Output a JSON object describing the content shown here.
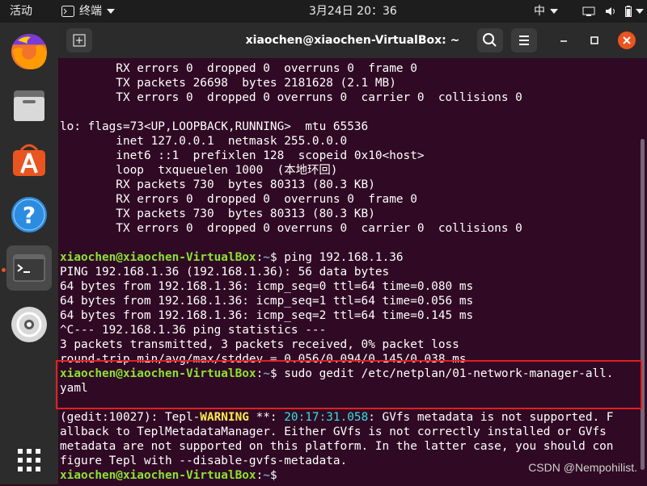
{
  "topbar": {
    "activities": "活动",
    "app_menu": "终端",
    "clock": "3月24日  20：36",
    "input_method": "中"
  },
  "window": {
    "title": "xiaochen@xiaochen-VirtualBox: ~"
  },
  "dock": {
    "items": [
      "firefox-icon",
      "files-icon",
      "software-icon",
      "help-icon",
      "terminal-icon",
      "dvd-icon"
    ],
    "apps_grid": "show-applications-icon"
  },
  "terminal": {
    "lines": [
      "        RX errors 0  dropped 0  overruns 0  frame 0",
      "        TX packets 26698  bytes 2181628 (2.1 MB)",
      "        TX errors 0  dropped 0 overruns 0  carrier 0  collisions 0",
      "",
      "lo: flags=73<UP,LOOPBACK,RUNNING>  mtu 65536",
      "        inet 127.0.0.1  netmask 255.0.0.0",
      "        inet6 ::1  prefixlen 128  scopeid 0x10<host>",
      "        loop  txqueuelen 1000  (本地环回)",
      "        RX packets 730  bytes 80313 (80.3 KB)",
      "        RX errors 0  dropped 0  overruns 0  frame 0",
      "        TX packets 730  bytes 80313 (80.3 KB)",
      "        TX errors 0  dropped 0 overruns 0  carrier 0  collisions 0",
      ""
    ],
    "prompt_user": "xiaochen@xiaochen-VirtualBox",
    "prompt_sep": ":",
    "prompt_path": "~",
    "prompt_sym": "$",
    "cmd1": " ping 192.168.1.36",
    "ping_output": [
      "PING 192.168.1.36 (192.168.1.36): 56 data bytes",
      "64 bytes from 192.168.1.36: icmp_seq=0 ttl=64 time=0.080 ms",
      "64 bytes from 192.168.1.36: icmp_seq=1 ttl=64 time=0.056 ms",
      "64 bytes from 192.168.1.36: icmp_seq=2 ttl=64 time=0.145 ms",
      "^C--- 192.168.1.36 ping statistics ---",
      "3 packets transmitted, 3 packets received, 0% packet loss",
      "round-trip min/avg/max/stddev = 0.056/0.094/0.145/0.038 ms"
    ],
    "cmd2_part1": " sudo gedit /etc/netplan/01-network-manager-all.",
    "cmd2_part2": "yaml",
    "gedit_prefix": "(gedit:10027): Tepl-",
    "gedit_warning": "WARNING",
    "gedit_stars": " **: ",
    "gedit_time": "20:17:31.058",
    "gedit_msg1": ": GVfs metadata is not supported. F",
    "gedit_msg_lines": [
      "allback to TeplMetadataManager. Either GVfs is not correctly installed or GVfs",
      "metadata are not supported on this platform. In the latter case, you should con",
      "figure Tepl with --disable-gvfs-metadata."
    ]
  },
  "watermark": "CSDN @Nempohilist."
}
